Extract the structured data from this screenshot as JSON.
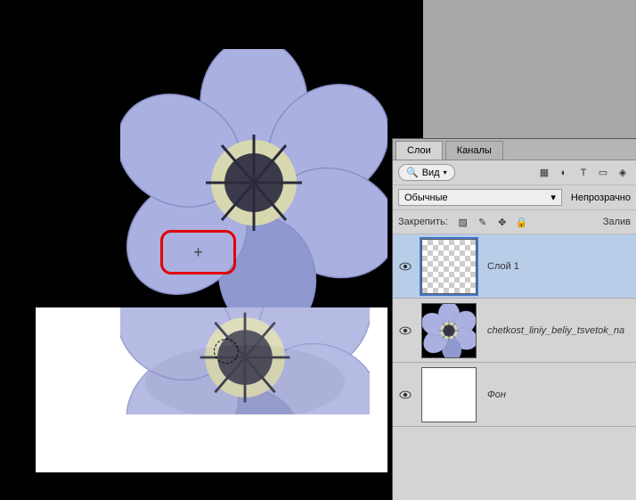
{
  "canvas": {
    "crosshair": "+"
  },
  "panel": {
    "tabs": {
      "layers": "Слои",
      "channels": "Каналы"
    },
    "filter": {
      "label": "Вид"
    },
    "blend": {
      "mode": "Обычные",
      "opacity_label": "Непрозрачно"
    },
    "lock": {
      "label": "Закрепить:",
      "fill_label": "Залив"
    }
  },
  "layers": [
    {
      "name": "Слой 1",
      "visible": true,
      "selected": true,
      "thumb": "empty"
    },
    {
      "name": "chetkost_liniy_beliy_tsvetok_na",
      "visible": true,
      "selected": false,
      "thumb": "flower"
    },
    {
      "name": "Фон",
      "visible": true,
      "selected": false,
      "thumb": "white"
    }
  ]
}
